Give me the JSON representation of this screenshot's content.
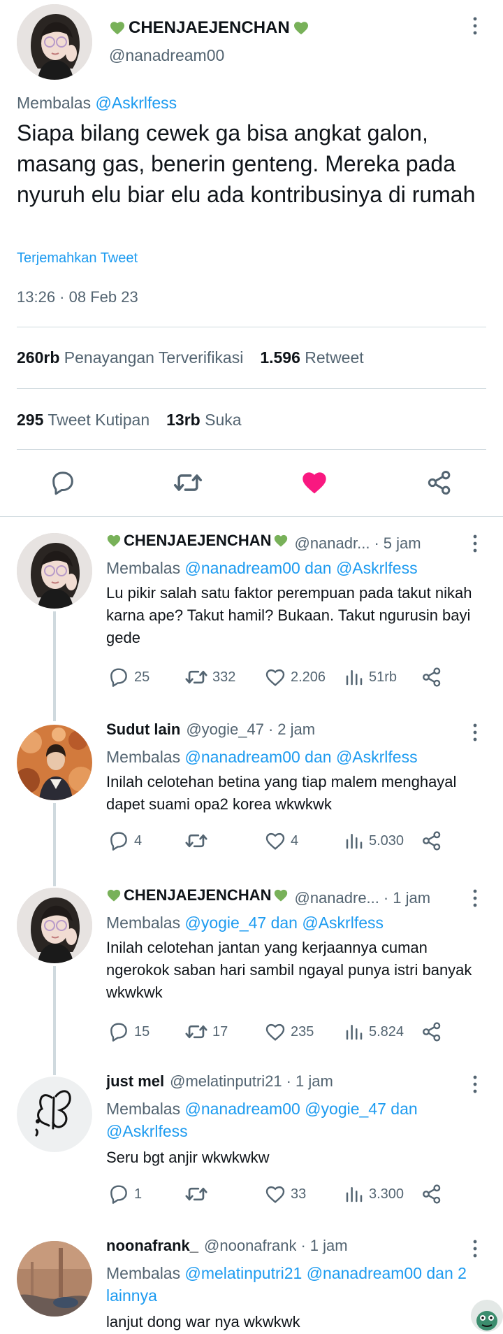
{
  "main_tweet": {
    "display_name": "CHENJAEJENCHAN",
    "handle": "@nanadream00",
    "reply_prefix": "Membalas",
    "reply_to": "@Askrlfess",
    "text": "Siapa bilang cewek ga bisa angkat galon, masang gas, benerin genteng. Mereka pada nyuruh elu biar elu ada kontribusinya di rumah",
    "translate_label": "Terjemahkan Tweet",
    "timestamp": "13:26 · 08 Feb 23",
    "stats": {
      "views_value": "260rb",
      "views_label": "Penayangan Terverifikasi",
      "retweets_value": "1.596",
      "retweets_label": "Retweet",
      "quotes_value": "295",
      "quotes_label": "Tweet Kutipan",
      "likes_value": "13rb",
      "likes_label": "Suka"
    },
    "liked": true,
    "like_color": "#f91880"
  },
  "replies": [
    {
      "display_name": "CHENJAEJENCHAN",
      "handle": "@nanadr...",
      "time": "5 jam",
      "reply_prefix": "Membalas",
      "reply_to": "@nanadream00 dan @Askrlfess",
      "text": "Lu pikir salah satu faktor perempuan pada takut nikah karna ape? Takut hamil? Bukaan. Takut ngurusin bayi gede",
      "replies": "25",
      "retweets": "332",
      "likes": "2.206",
      "views": "51rb"
    },
    {
      "display_name": "Sudut lain",
      "handle": "@yogie_47",
      "time": "2 jam",
      "reply_prefix": "Membalas",
      "reply_to": "@nanadream00 dan @Askrlfess",
      "text": "Inilah celotehan betina yang tiap malem menghayal dapet suami opa2 korea wkwkwk",
      "replies": "4",
      "retweets": "",
      "likes": "4",
      "views": "5.030"
    },
    {
      "display_name": "CHENJAEJENCHAN",
      "handle": "@nanadre...",
      "time": "1 jam",
      "reply_prefix": "Membalas",
      "reply_to": "@yogie_47 dan @Askrlfess",
      "text": "Inilah celotehan jantan yang kerjaannya cuman ngerokok saban hari sambil ngayal punya istri banyak wkwkwk",
      "replies": "15",
      "retweets": "17",
      "likes": "235",
      "views": "5.824"
    },
    {
      "display_name": "just mel",
      "handle": "@melatinputri21",
      "time": "1 jam",
      "reply_prefix": "Membalas",
      "reply_to": "@nanadream00 @yogie_47 dan @Askrlfess",
      "text": "Seru bgt anjir wkwkwkw",
      "replies": "1",
      "retweets": "",
      "likes": "33",
      "views": "3.300"
    },
    {
      "display_name": "noonafrank_",
      "handle": "@noonafrank",
      "time": "1 jam",
      "reply_prefix": "Membalas",
      "reply_to": "@melatinputri21 @nanadream00 dan 2 lainnya",
      "text": "lanjut dong war nya wkwkwk"
    }
  ],
  "colors": {
    "accent": "#1d9bf0",
    "heart_emoji": "#78b159",
    "text_secondary": "#536471",
    "divider": "#cfd9de"
  }
}
